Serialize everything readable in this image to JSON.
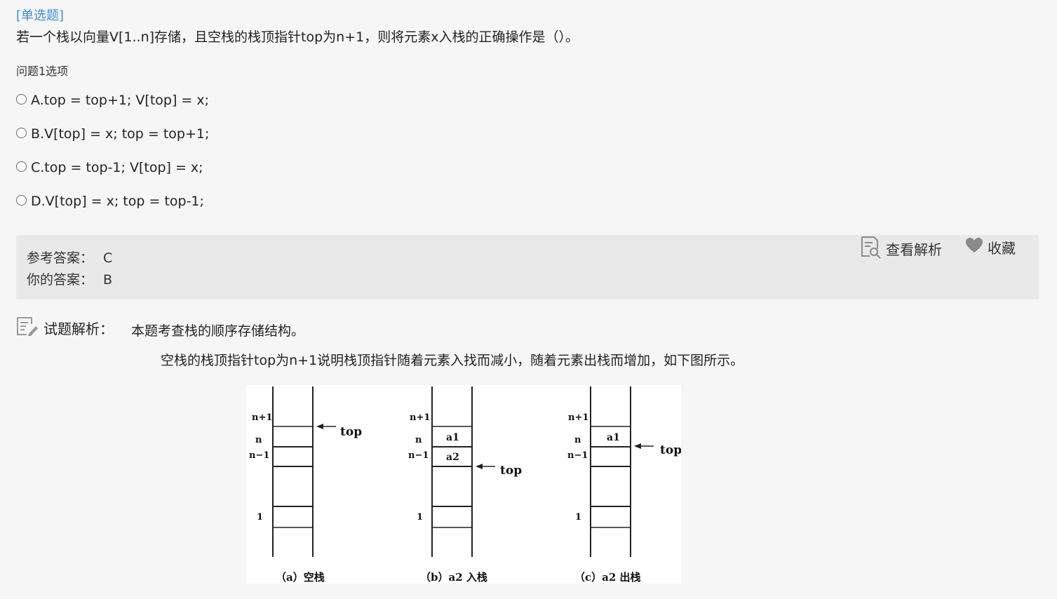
{
  "question": {
    "type_label": "[单选题]",
    "stem": "若一个栈以向量V[1..n]存储，且空栈的栈顶指针top为n+1，则将元素x入栈的正确操作是（）。",
    "options_caption": "问题1选项",
    "options": [
      {
        "label": "A.top = top+1; V[top] = x;"
      },
      {
        "label": "B.V[top] = x; top = top+1;"
      },
      {
        "label": "C.top = top-1; V[top] = x;"
      },
      {
        "label": "D.V[top] = x; top = top-1;"
      }
    ]
  },
  "answer": {
    "reference_label": "参考答案：",
    "reference_value": "C",
    "yours_label": "你的答案：",
    "yours_value": "B",
    "view_analysis_label": "查看解析",
    "favorite_label": "收藏"
  },
  "explanation": {
    "title": "试题解析：",
    "line1": "本题考查栈的顺序存储结构。",
    "line2": "空栈的栈顶指针top为n+1说明栈顶指针随着元素入找而减小，随着元素出栈而增加，如下图所示。"
  },
  "figure": {
    "row_labels": [
      "n+1",
      "n",
      "n−1",
      "1"
    ],
    "top_label": "top",
    "stacks": [
      {
        "caption": "（a）空栈",
        "cells": [
          "",
          ""
        ]
      },
      {
        "caption": "（b）a2 入栈",
        "cells": [
          "a1",
          "a2"
        ]
      },
      {
        "caption": "（c）a2 出栈",
        "cells": [
          "a1",
          ""
        ]
      }
    ]
  },
  "colors": {
    "type_label": "#3b8fd8",
    "answer_box_bg": "#e9e9e9",
    "page_bg": "#f6f6f6",
    "icon_gray": "#8a8a8a"
  }
}
